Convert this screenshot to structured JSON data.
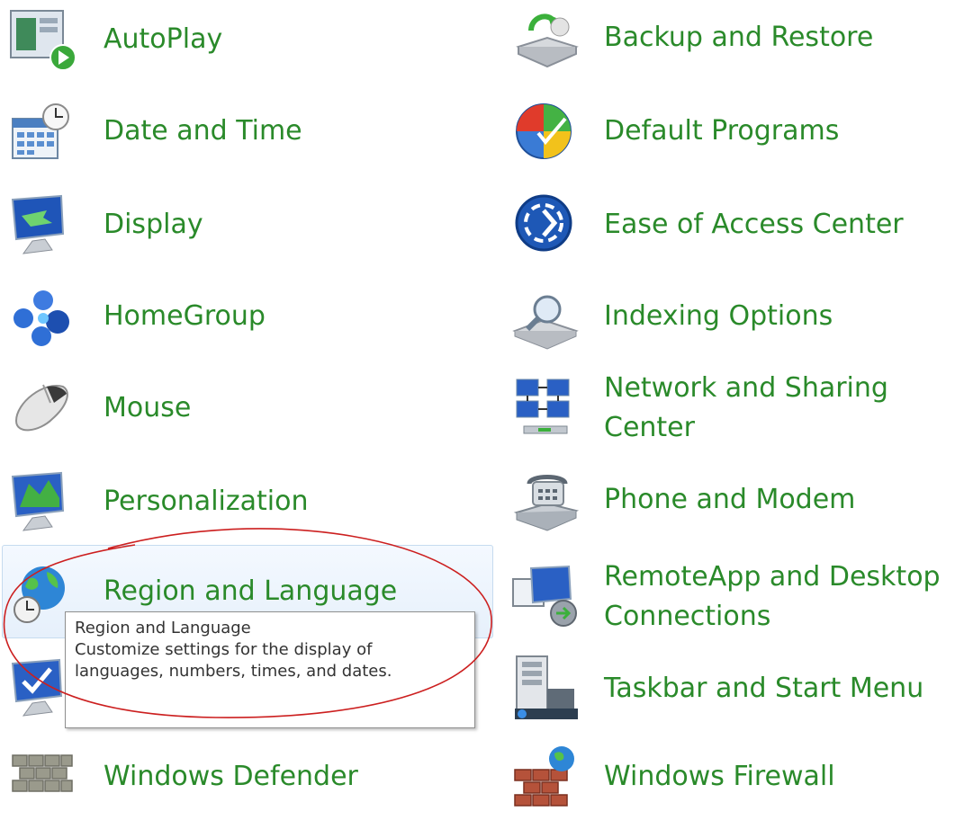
{
  "items_left": [
    {
      "label": "AutoPlay",
      "icon": "autoplay-icon"
    },
    {
      "label": "Date and Time",
      "icon": "date-time-icon"
    },
    {
      "label": "Display",
      "icon": "display-icon"
    },
    {
      "label": "HomeGroup",
      "icon": "homegroup-icon"
    },
    {
      "label": "Mouse",
      "icon": "mouse-icon"
    },
    {
      "label": "Personalization",
      "icon": "personalization-icon"
    },
    {
      "label": "Region and Language",
      "icon": "globe-clock-icon"
    },
    {
      "label": "",
      "icon": "monitor-check-icon"
    },
    {
      "label": "Windows Defender",
      "icon": "defender-wall-icon"
    }
  ],
  "items_right": [
    {
      "label": "Backup and Restore",
      "icon": "backup-restore-icon"
    },
    {
      "label": "Default Programs",
      "icon": "default-programs-icon"
    },
    {
      "label": "Ease of Access Center",
      "icon": "ease-of-access-icon"
    },
    {
      "label": "Indexing Options",
      "icon": "indexing-options-icon"
    },
    {
      "label": "Network and Sharing",
      "label2": "Center",
      "icon": "network-icon"
    },
    {
      "label": "Phone and Modem",
      "icon": "phone-modem-icon"
    },
    {
      "label": "RemoteApp and Desktop",
      "label2": "Connections",
      "icon": "remoteapp-icon"
    },
    {
      "label": "Taskbar and Start Menu",
      "icon": "taskbar-icon"
    },
    {
      "label": "Windows Firewall",
      "icon": "firewall-icon"
    }
  ],
  "tooltip": {
    "title": "Region and Language",
    "description": "Customize settings for the display of languages, numbers, times, and dates."
  },
  "colors": {
    "link": "#2a8a2a",
    "annotation": "#cc1f1f",
    "hover_border": "#c6dbef"
  }
}
